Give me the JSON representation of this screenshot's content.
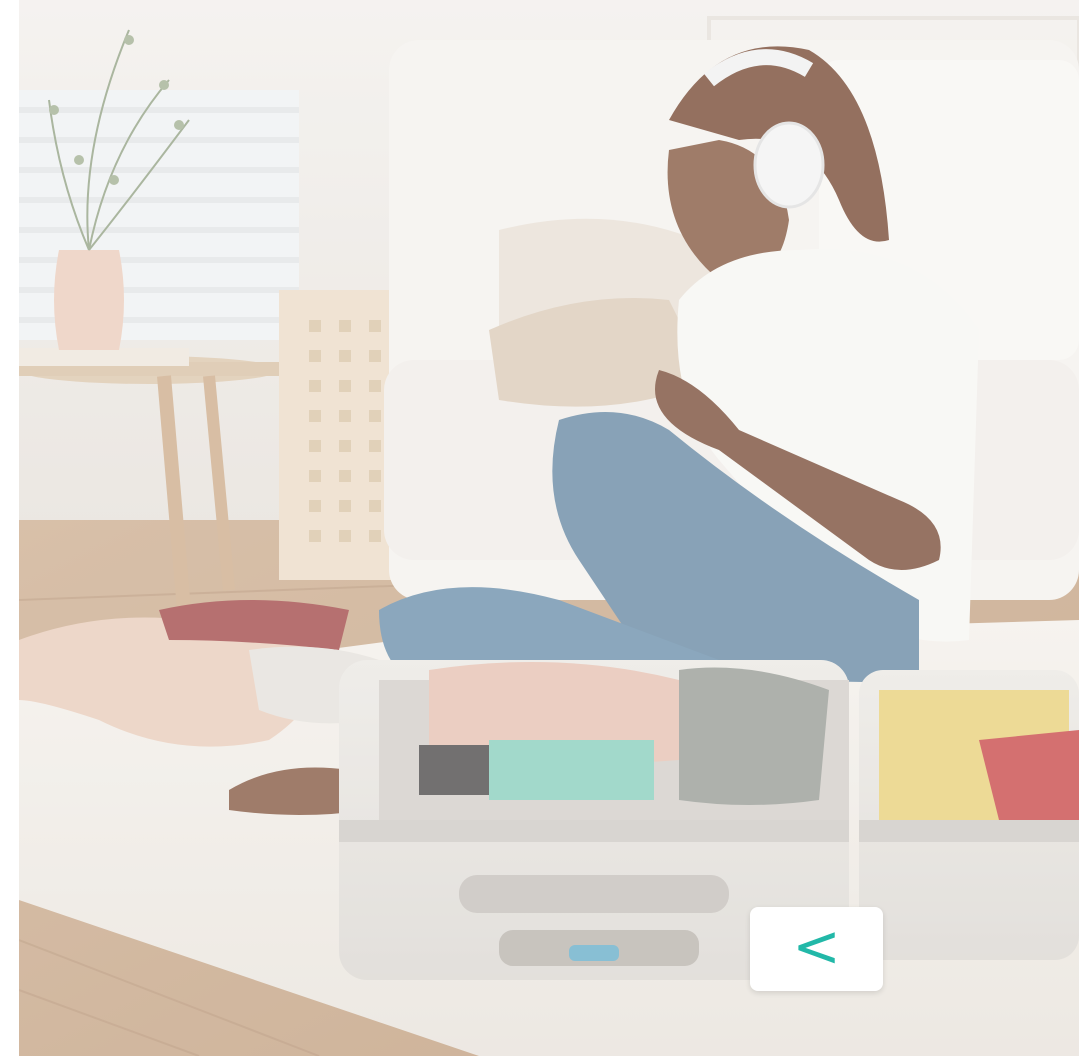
{
  "photo": {
    "subject": "woman-with-headphones-packing-suitcase"
  },
  "carousel": {
    "prev_icon": "chevron-left-icon",
    "prev_glyph": "<"
  },
  "colors": {
    "accent": "#22b8a8",
    "button_bg": "#ffffff"
  }
}
